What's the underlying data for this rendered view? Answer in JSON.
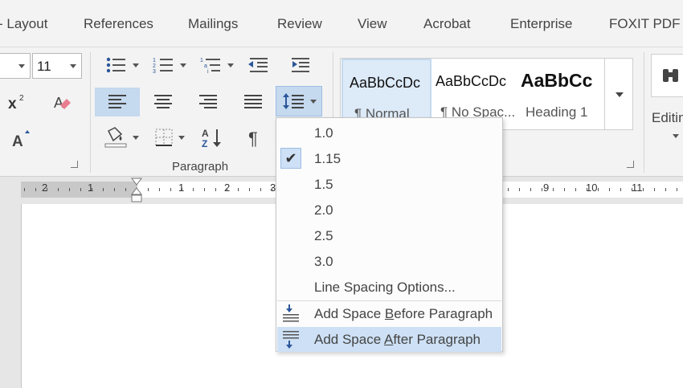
{
  "tabs": [
    "Layout",
    "References",
    "Mailings",
    "Review",
    "View",
    "Acrobat",
    "Enterprise",
    "FOXIT PDF"
  ],
  "font": {
    "size_value": "11"
  },
  "paragraph_group": {
    "label": "Paragraph"
  },
  "styles": [
    {
      "sample": "AaBbCcDc",
      "name": "¶ Normal"
    },
    {
      "sample": "AaBbCcDc",
      "name": "¶ No Spac..."
    },
    {
      "sample": "AaBbCc",
      "name": "Heading 1"
    }
  ],
  "editing": {
    "label": "Editing"
  },
  "ruler": {
    "numbers": [
      "2",
      "1",
      "1",
      "2",
      "3",
      "9",
      "10",
      "11"
    ]
  },
  "line_spacing_menu": {
    "options": [
      "1.0",
      "1.15",
      "1.5",
      "2.0",
      "2.5",
      "3.0"
    ],
    "selected": "1.15",
    "options_label": "Line Spacing Options...",
    "space_before": {
      "pre": "Add Space ",
      "key": "B",
      "post": "efore Paragraph"
    },
    "space_after": {
      "pre": "Add Space ",
      "key": "A",
      "post": "fter Paragraph"
    }
  },
  "colors": {
    "accent": "#2b579a",
    "selected_bg": "#c5d9ef",
    "hover_bg": "#cde0f5"
  }
}
